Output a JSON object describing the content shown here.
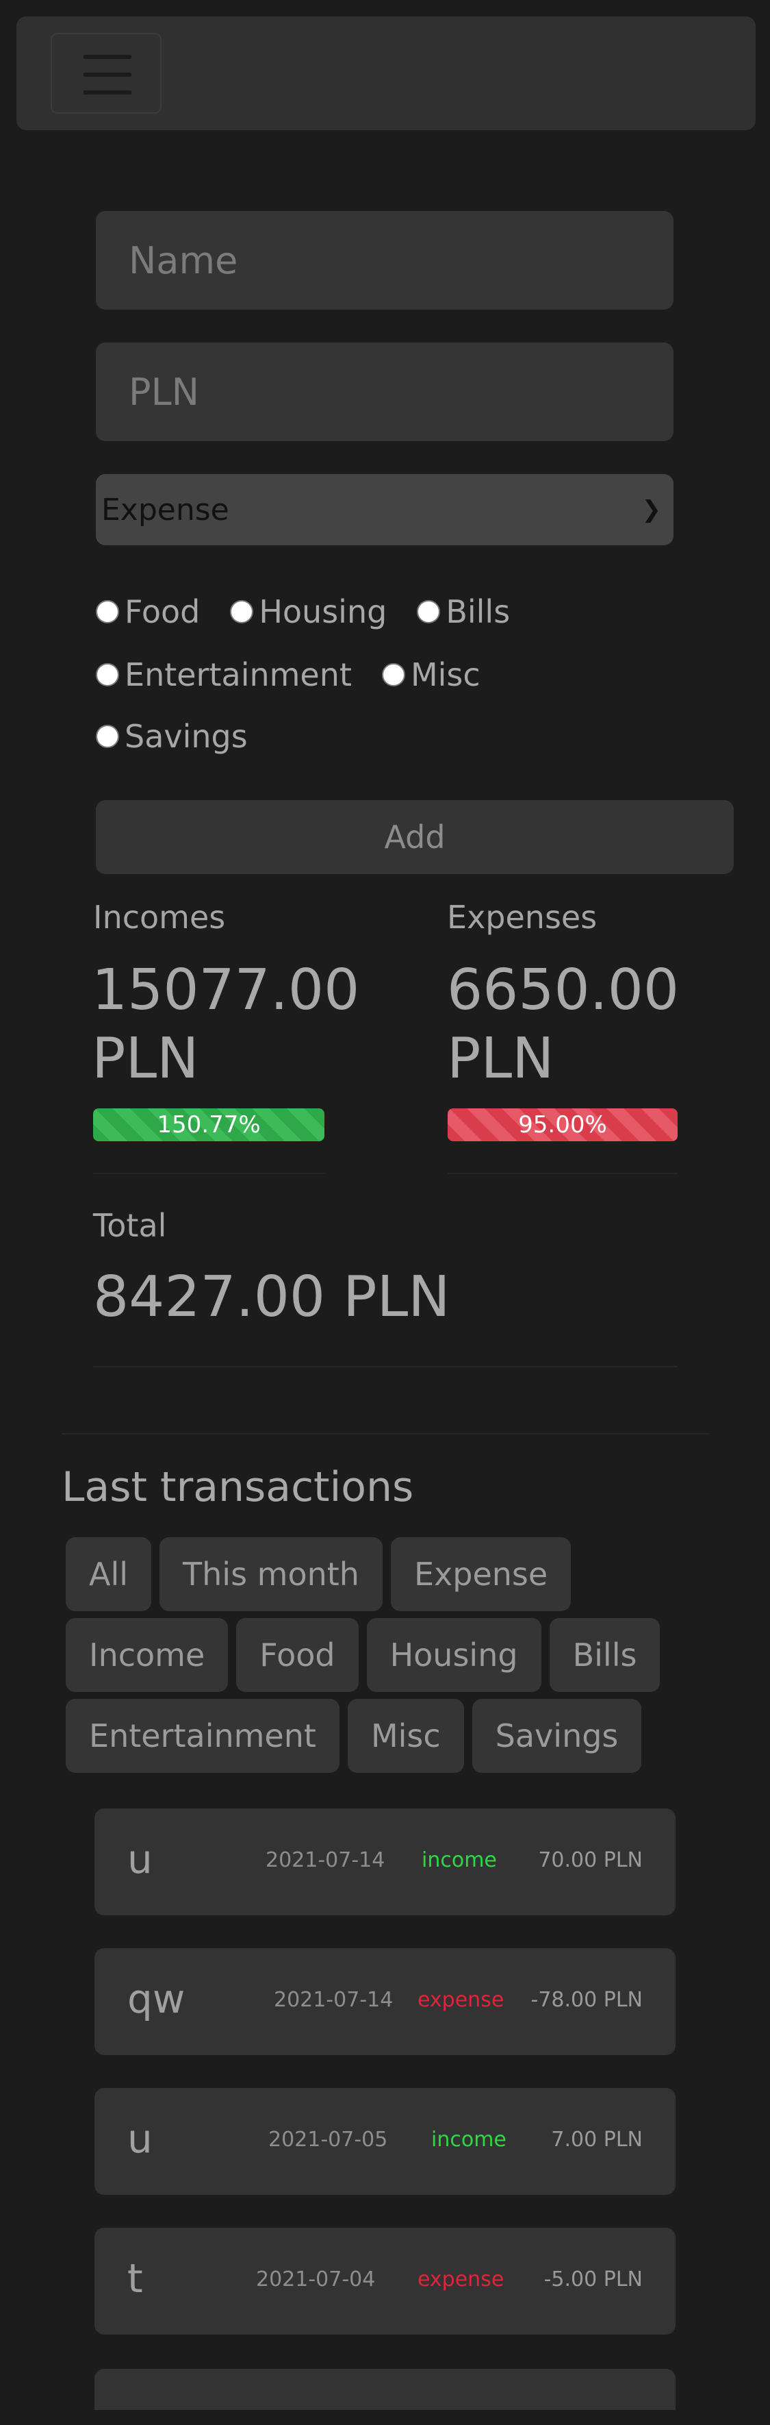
{
  "form": {
    "name_placeholder": "Name",
    "amount_placeholder": "PLN",
    "type_selected": "Expense",
    "categories": [
      "Food",
      "Housing",
      "Bills",
      "Entertainment",
      "Misc",
      "Savings"
    ],
    "add_label": "Add"
  },
  "stats": {
    "incomes_label": "Incomes",
    "incomes_value_line1": "15077.00",
    "incomes_value_line2": "PLN",
    "incomes_percent_text": "150.77%",
    "incomes_percent": 150.77,
    "expenses_label": "Expenses",
    "expenses_value_line1": "6650.00",
    "expenses_value_line2": "PLN",
    "expenses_percent_text": "95.00%",
    "expenses_percent": 95.0,
    "total_label": "Total",
    "total_value": "8427.00 PLN"
  },
  "transactions_section": {
    "title": "Last transactions",
    "filters": [
      "All",
      "This month",
      "Expense",
      "Income",
      "Food",
      "Housing",
      "Bills",
      "Entertainment",
      "Misc",
      "Savings"
    ]
  },
  "transactions": [
    {
      "name": "u",
      "date": "2021-07-14",
      "type": "income",
      "amount": "70.00 PLN"
    },
    {
      "name": "qw",
      "date": "2021-07-14",
      "type": "expense",
      "amount": "-78.00 PLN"
    },
    {
      "name": "u",
      "date": "2021-07-05",
      "type": "income",
      "amount": "7.00 PLN"
    },
    {
      "name": "t",
      "date": "2021-07-04",
      "type": "expense",
      "amount": "-5.00 PLN"
    }
  ],
  "colors": {
    "background": "#1c1c1c",
    "income_green": "#2ed845",
    "expense_red": "#e0243b",
    "progress_green": "#3dbb59",
    "progress_red": "#e55a66"
  }
}
